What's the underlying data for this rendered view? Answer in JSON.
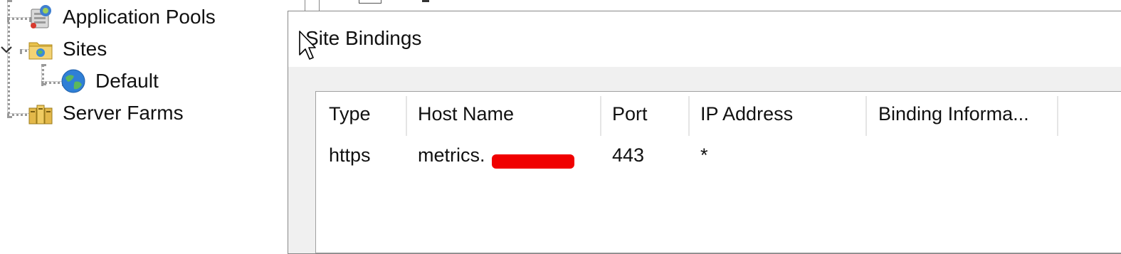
{
  "tree": {
    "items": [
      {
        "label": "Application Pools",
        "icon": "app-pools-icon"
      },
      {
        "label": "Sites",
        "icon": "folder-sites-icon"
      },
      {
        "label": "Default",
        "icon": "globe-icon"
      },
      {
        "label": "Server Farms",
        "icon": "server-farm-icon"
      }
    ]
  },
  "dialog": {
    "title": "Site Bindings",
    "columns": [
      "Type",
      "Host Name",
      "Port",
      "IP Address",
      "Binding Informa..."
    ],
    "rows": [
      {
        "type": "https",
        "host": "metrics.",
        "port": "443",
        "ip": "*",
        "info": ""
      }
    ]
  },
  "colors": {
    "dialog_body": "#f0f0f0",
    "redaction": "#f00000"
  }
}
